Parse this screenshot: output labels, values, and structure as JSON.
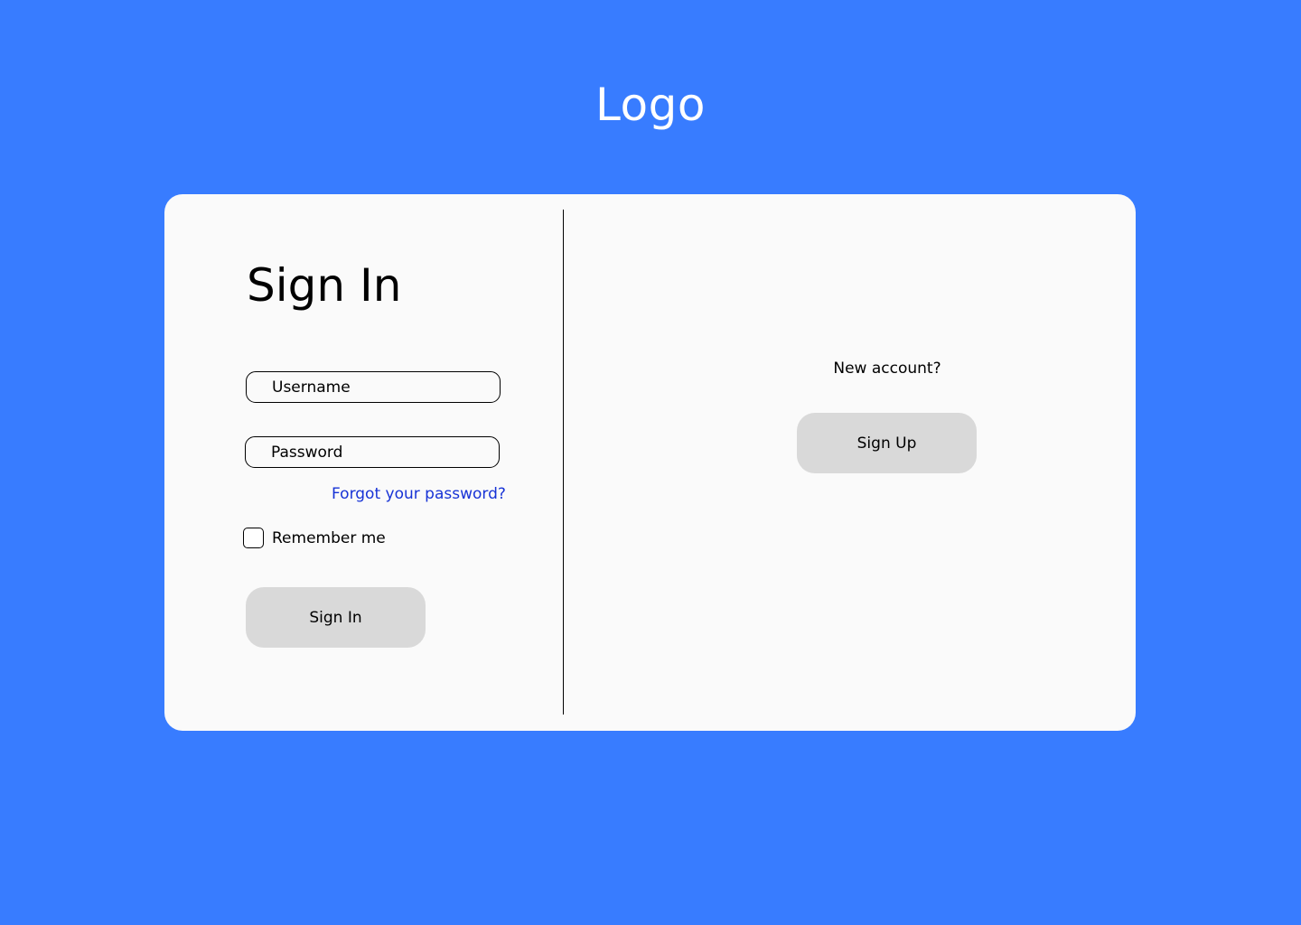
{
  "header": {
    "logo_text": "Logo"
  },
  "signin": {
    "title": "Sign In",
    "username_placeholder": "Username",
    "password_placeholder": "Password",
    "forgot_link": "Forgot your password?",
    "remember_label": "Remember me",
    "remember_checked": false,
    "button_label": "Sign In"
  },
  "signup": {
    "prompt": "New account?",
    "button_label": "Sign Up"
  },
  "colors": {
    "background": "#387CFF",
    "card": "#FAFAFA",
    "button": "#D9D9D9",
    "link": "#1733D6"
  }
}
